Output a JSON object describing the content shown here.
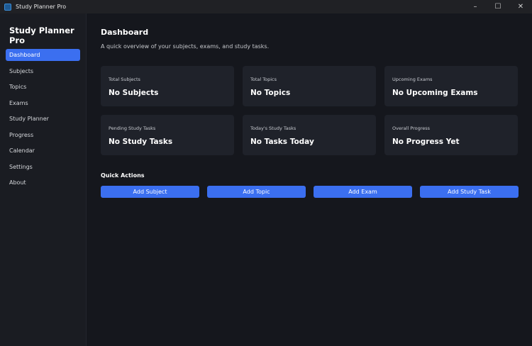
{
  "window": {
    "title": "Study Planner Pro"
  },
  "sidebar": {
    "app_name": "Study Planner Pro",
    "items": [
      {
        "label": "Dashboard",
        "active": true
      },
      {
        "label": "Subjects"
      },
      {
        "label": "Topics"
      },
      {
        "label": "Exams"
      },
      {
        "label": "Study Planner"
      },
      {
        "label": "Progress"
      },
      {
        "label": "Calendar"
      },
      {
        "label": "Settings"
      },
      {
        "label": "About"
      }
    ]
  },
  "main": {
    "title": "Dashboard",
    "subtitle": "A quick overview of your subjects, exams, and study tasks.",
    "cards": [
      {
        "label": "Total Subjects",
        "value": "No Subjects"
      },
      {
        "label": "Total Topics",
        "value": "No Topics"
      },
      {
        "label": "Upcoming Exams",
        "value": "No Upcoming Exams"
      },
      {
        "label": "Pending Study Tasks",
        "value": "No Study Tasks"
      },
      {
        "label": "Today's Study Tasks",
        "value": "No Tasks Today"
      },
      {
        "label": "Overall Progress",
        "value": "No Progress Yet"
      }
    ],
    "quick_actions": {
      "title": "Quick Actions",
      "buttons": [
        "Add Subject",
        "Add Topic",
        "Add Exam",
        "Add Study Task"
      ]
    }
  },
  "colors": {
    "accent": "#3b6ff0",
    "background": "#15171d",
    "sidebar": "#1a1c22",
    "card": "#1f222a"
  }
}
